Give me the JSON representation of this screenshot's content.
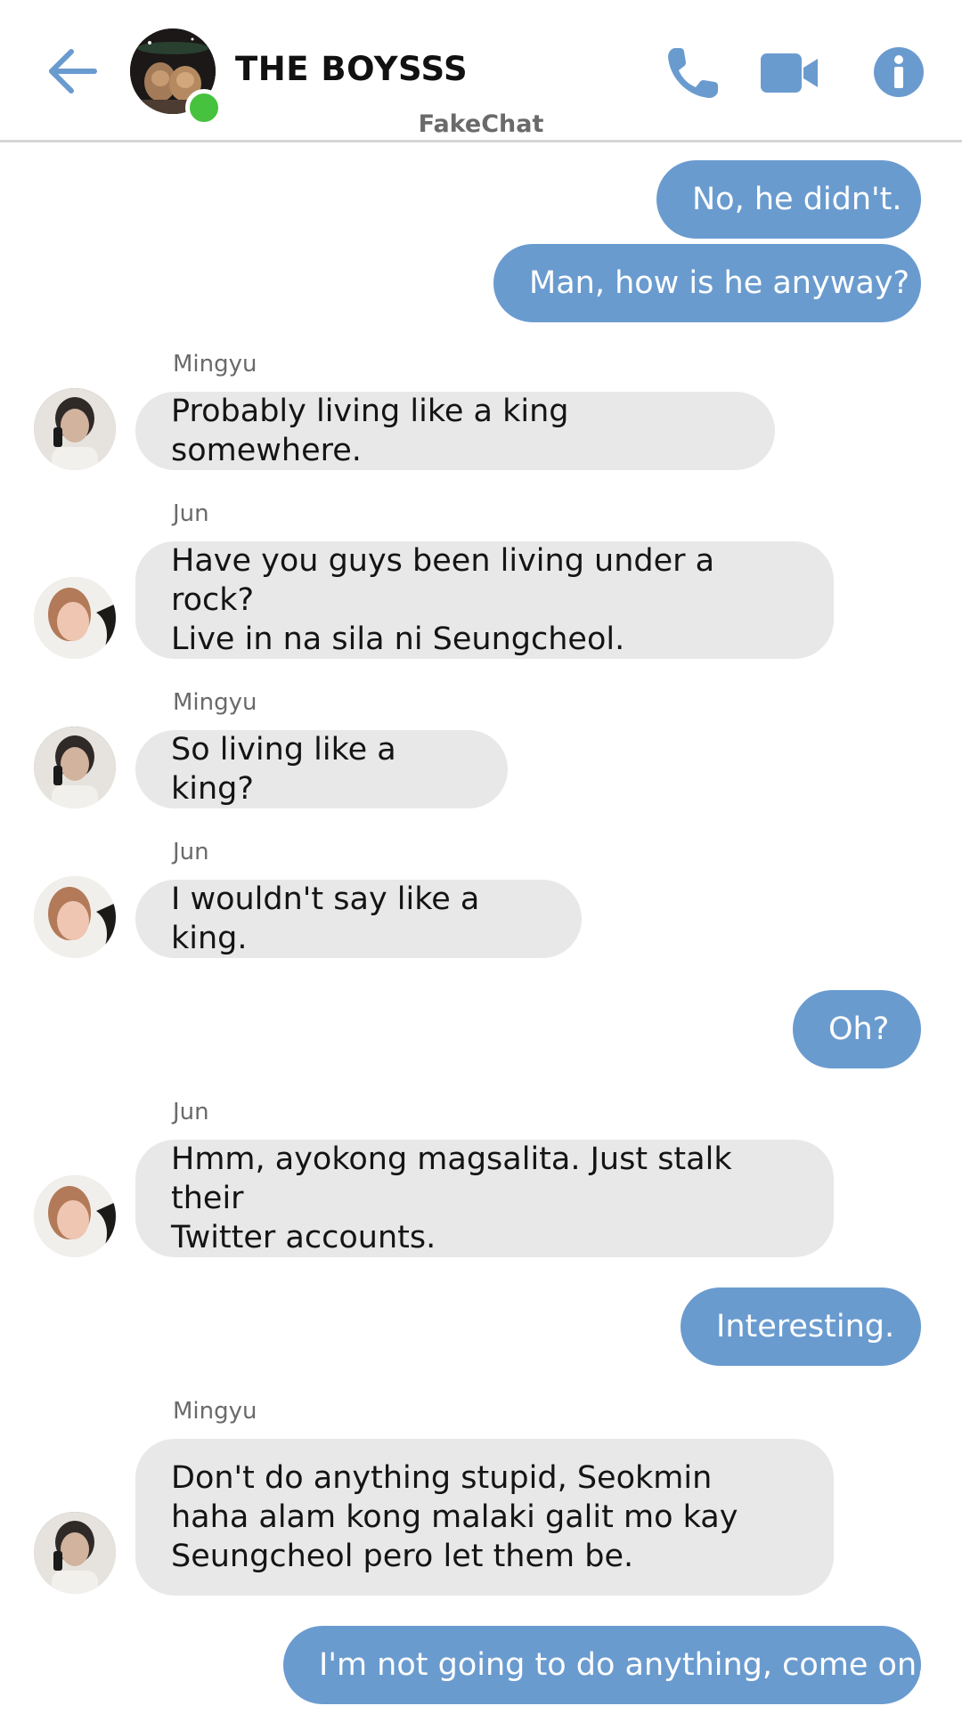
{
  "header": {
    "title": "THE BOYSSS",
    "app_name": "FakeChat",
    "back_icon": "back-arrow-icon",
    "call_icon": "phone-icon",
    "video_icon": "video-camera-icon",
    "info_icon": "info-icon",
    "accent_color": "#6a9bcf",
    "online_color": "#47c23f"
  },
  "messages": [
    {
      "direction": "out",
      "text": "No, he didn't."
    },
    {
      "direction": "out",
      "text": "Man, how is he anyway?"
    },
    {
      "direction": "in",
      "sender": "Mingyu",
      "text": "Probably living like a king somewhere."
    },
    {
      "direction": "in",
      "sender": "Jun",
      "text": "Have you guys been living under a rock?\nLive in na sila ni Seungcheol."
    },
    {
      "direction": "in",
      "sender": "Mingyu",
      "text": "So living like a king?"
    },
    {
      "direction": "in",
      "sender": "Jun",
      "text": "I wouldn't say like a king."
    },
    {
      "direction": "out",
      "text": "Oh?"
    },
    {
      "direction": "in",
      "sender": "Jun",
      "text": "Hmm, ayokong magsalita. Just stalk their\nTwitter accounts."
    },
    {
      "direction": "out",
      "text": "Interesting."
    },
    {
      "direction": "in",
      "sender": "Mingyu",
      "text": "Don't do anything stupid, Seokmin\nhaha alam kong malaki galit mo kay\nSeungcheol pero let them be."
    },
    {
      "direction": "out",
      "text": "I'm not going to do anything, come on."
    }
  ],
  "colors": {
    "outgoing_bubble": "#6a9bcf",
    "incoming_bubble": "#e8e8e8"
  }
}
